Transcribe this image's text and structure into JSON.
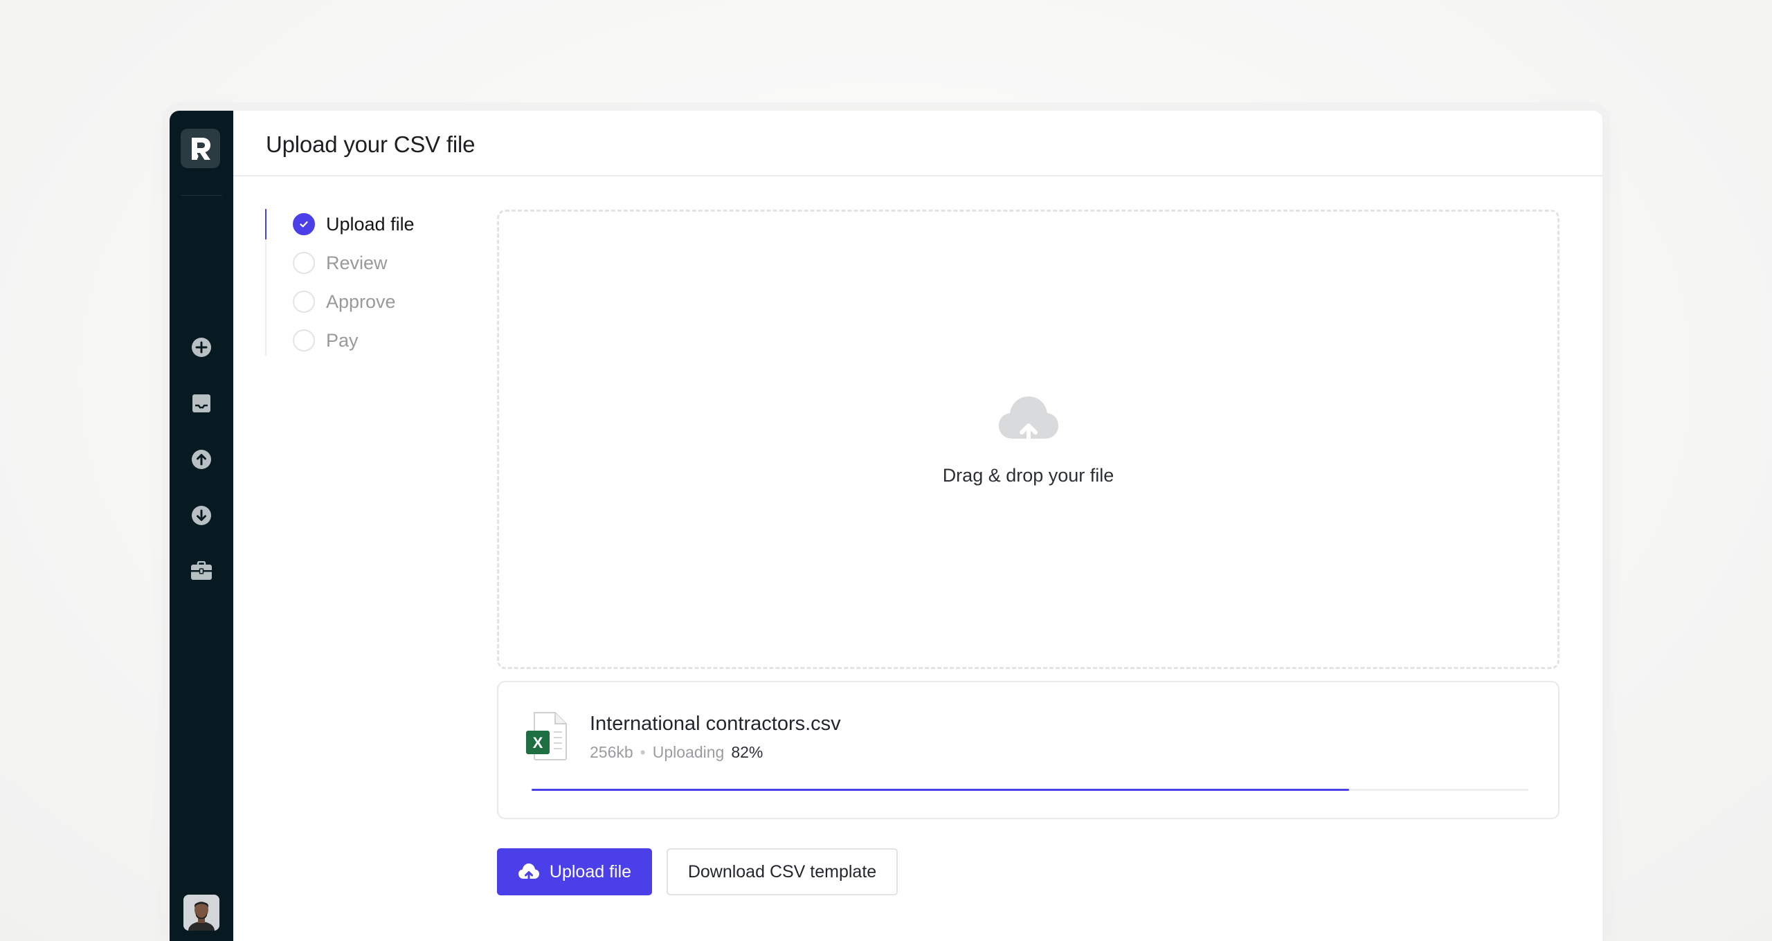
{
  "sidebar": {
    "logo_letter": "R",
    "items": [
      {
        "icon": "plus-circle-icon"
      },
      {
        "icon": "inbox-icon"
      },
      {
        "icon": "upload-circle-icon"
      },
      {
        "icon": "download-circle-icon"
      },
      {
        "icon": "briefcase-icon"
      }
    ],
    "bottom_items": [
      {
        "icon": "piggy-bank-icon"
      },
      {
        "icon": "avatar"
      }
    ]
  },
  "header": {
    "title": "Upload your CSV file"
  },
  "steps": [
    {
      "label": "Upload file",
      "state": "done"
    },
    {
      "label": "Review",
      "state": "pending"
    },
    {
      "label": "Approve",
      "state": "pending"
    },
    {
      "label": "Pay",
      "state": "pending"
    }
  ],
  "dropzone": {
    "icon": "cloud-upload-icon",
    "text": "Drag & drop your file"
  },
  "file": {
    "icon": "excel-file-icon",
    "icon_letter": "X",
    "name": "International contractors.csv",
    "size": "256kb",
    "bullet": "•",
    "status": "Uploading",
    "percent": "82%",
    "progress": 0.82
  },
  "actions": {
    "upload_label": "Upload file",
    "download_label": "Download CSV template"
  },
  "colors": {
    "accent": "#4a3fe8",
    "sidebar_bg": "#071a21",
    "excel_green": "#1d6f42"
  }
}
